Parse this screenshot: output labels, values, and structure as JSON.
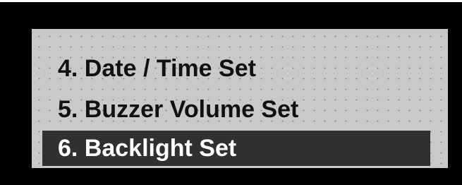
{
  "menu": {
    "items": [
      {
        "label": "4. Date / Time Set",
        "selected": false
      },
      {
        "label": "5. Buzzer Volume Set",
        "selected": false
      },
      {
        "label": "6. Backlight Set",
        "selected": true
      }
    ]
  },
  "colors": {
    "bezel": "#000000",
    "lcd_background": "#c9c9c9",
    "lcd_text": "#111111",
    "highlight_background": "#303030",
    "highlight_text": "#ffffff"
  }
}
